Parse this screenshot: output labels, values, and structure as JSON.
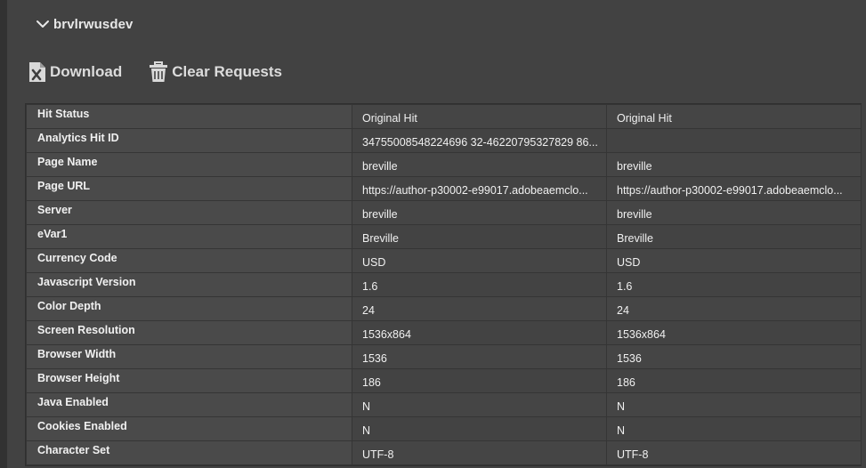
{
  "section": {
    "title": "brvlrwusdev",
    "icon": "chevron-down-icon"
  },
  "toolbar": {
    "download_label": "Download",
    "clear_label": "Clear Requests"
  },
  "table": {
    "rows": [
      {
        "label": "Hit Status",
        "v1": "Original Hit",
        "v2": "Original Hit"
      },
      {
        "label": "Analytics Hit ID",
        "v1": "34755008548224696 32-46220795327829 86...",
        "v2": ""
      },
      {
        "label": "Page Name",
        "v1": "breville",
        "v2": "breville"
      },
      {
        "label": "Page URL",
        "v1": "https://author-p30002-e99017.adobeaemclo...",
        "v2": "https://author-p30002-e99017.adobeaemclo..."
      },
      {
        "label": "Server",
        "v1": "breville",
        "v2": "breville"
      },
      {
        "label": "eVar1",
        "v1": "Breville",
        "v2": "Breville"
      },
      {
        "label": "Currency Code",
        "v1": "USD",
        "v2": "USD"
      },
      {
        "label": "Javascript Version",
        "v1": "1.6",
        "v2": "1.6"
      },
      {
        "label": "Color Depth",
        "v1": "24",
        "v2": "24"
      },
      {
        "label": "Screen Resolution",
        "v1": "1536x864",
        "v2": "1536x864"
      },
      {
        "label": "Browser Width",
        "v1": "1536",
        "v2": "1536"
      },
      {
        "label": "Browser Height",
        "v1": "186",
        "v2": "186"
      },
      {
        "label": "Java Enabled",
        "v1": "N",
        "v2": "N"
      },
      {
        "label": "Cookies Enabled",
        "v1": "N",
        "v2": "N"
      },
      {
        "label": "Character Set",
        "v1": "UTF-8",
        "v2": "UTF-8"
      }
    ]
  }
}
